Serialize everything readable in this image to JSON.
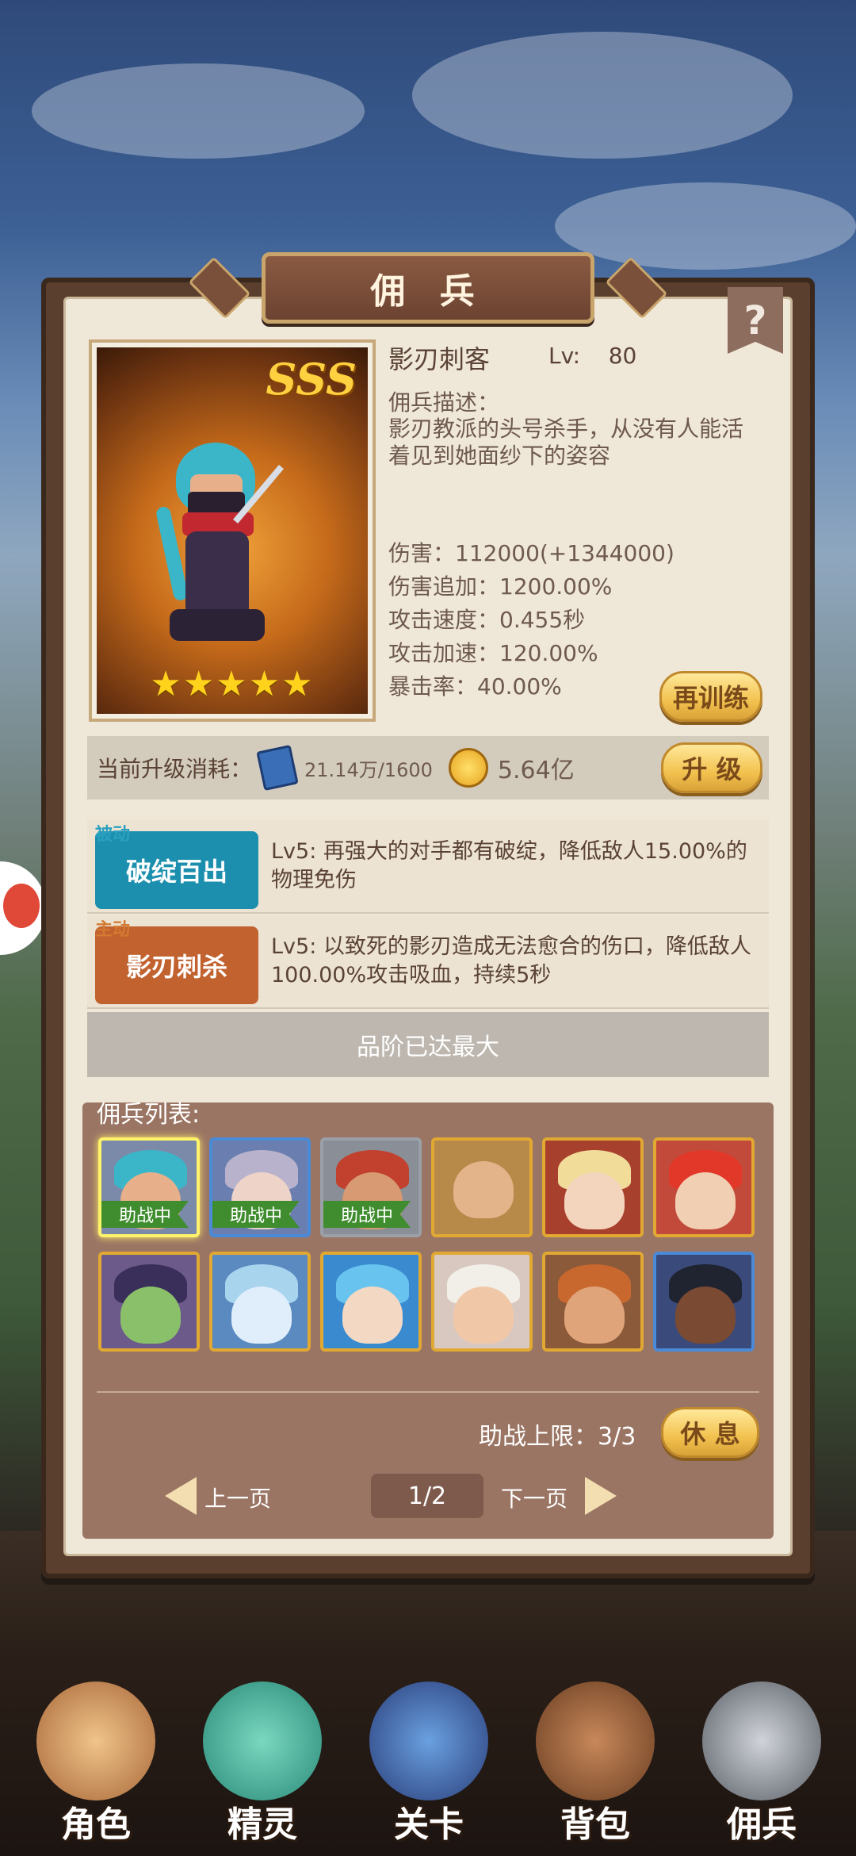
{
  "panel_title": "佣 兵",
  "help_label": "?",
  "hero": {
    "grade": "SSS",
    "stars": "★★★★★",
    "name": "影刃刺客",
    "lv_label": "Lv:",
    "lv_value": "80",
    "desc_title": "佣兵描述：",
    "desc_text": "影刃教派的头号杀手，从没有人能活着见到她面纱下的姿容",
    "stats": [
      "伤害：112000(+1344000)",
      "伤害追加：1200.00%",
      "攻击速度：0.455秒",
      "攻击加速：120.00%",
      "暴击率：40.00%"
    ],
    "retrain_label": "再训练"
  },
  "upgrade": {
    "cost_label": "当前升级消耗：",
    "book_cost": "21.14万/1600",
    "coin_cost": "5.64亿",
    "upgrade_label": "升 级"
  },
  "skills": [
    {
      "tag": "被动",
      "name": "破绽百出",
      "text": "Lv5:  再强大的对手都有破绽，降低敌人15.00%的物理免伤",
      "color": "#1d8fae",
      "tag_color": "#2aa0c0"
    },
    {
      "tag": "主动",
      "name": "影刃刺杀",
      "text": "Lv5:  以致死的影刃造成无法愈合的伤口，降低敌人100.00%攻击吸血，持续5秒",
      "color": "#c1622f",
      "tag_color": "#d47a30"
    }
  ],
  "max_grade_label": "品阶已达最大",
  "roster": {
    "title": "佣兵列表:",
    "assist_label": "助战中",
    "assist_limit": "助战上限：3/3",
    "rest_label": "休 息",
    "prev_label": "上一页",
    "next_label": "下一页",
    "page": "1/2"
  },
  "nav": [
    {
      "label": "角色",
      "icon": "character-icon"
    },
    {
      "label": "精灵",
      "icon": "spirit-icon"
    },
    {
      "label": "关卡",
      "icon": "stage-icon"
    },
    {
      "label": "背包",
      "icon": "backpack-icon"
    },
    {
      "label": "佣兵",
      "icon": "mercenary-icon"
    }
  ],
  "colors": {
    "gold_button": "#f2c24f",
    "panel_bg": "#efe7d8",
    "roster_bg": "#9b7564",
    "assist_green": "#3f8d2e"
  }
}
